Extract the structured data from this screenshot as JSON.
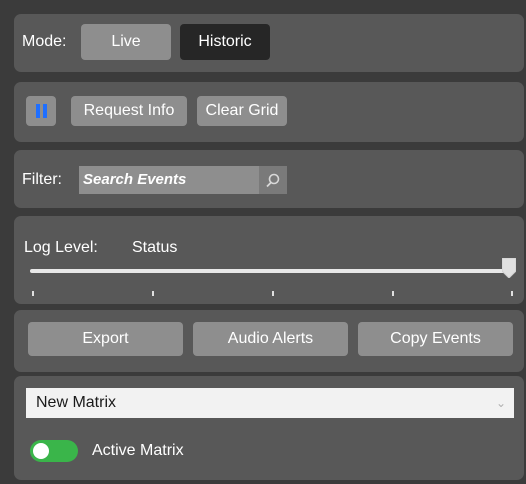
{
  "mode": {
    "label": "Mode:",
    "options": [
      "Live",
      "Historic"
    ],
    "selected": "Historic"
  },
  "controls": {
    "pause_icon": "pause-icon",
    "request_info": "Request Info",
    "clear_grid": "Clear Grid"
  },
  "filter": {
    "label": "Filter:",
    "placeholder": "Search Events",
    "search_icon": "search-icon"
  },
  "log": {
    "label": "Log Level:",
    "value": "Status",
    "slider_fraction": 1.0,
    "tick_count": 5
  },
  "actions": {
    "export": "Export",
    "audio_alerts": "Audio Alerts",
    "copy_events": "Copy Events"
  },
  "matrix": {
    "selected": "New Matrix",
    "toggle_label": "Active Matrix",
    "toggle_on": true
  },
  "colors": {
    "panel": "#585858",
    "button": "#8e8e8e",
    "selected_mode": "#262626",
    "toggle": "#3ab54a",
    "pause_accent": "#1f6fff"
  }
}
